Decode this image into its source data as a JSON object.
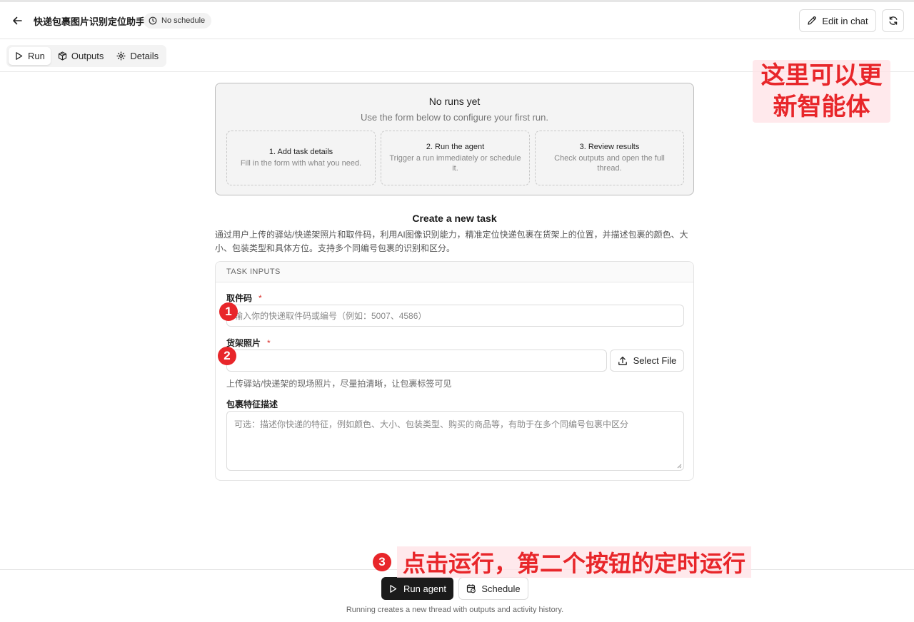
{
  "header": {
    "title": "快递包裹图片识别定位助手",
    "schedule_badge": "No schedule",
    "edit_chat_label": "Edit in chat"
  },
  "tabs": [
    {
      "label": "Run",
      "icon": "play-icon",
      "active": true
    },
    {
      "label": "Outputs",
      "icon": "box-icon",
      "active": false
    },
    {
      "label": "Details",
      "icon": "gear-icon",
      "active": false
    }
  ],
  "empty_state": {
    "title": "No runs yet",
    "subtitle": "Use the form below to configure your first run.",
    "steps": [
      {
        "title": "1. Add task details",
        "desc": "Fill in the form with what you need."
      },
      {
        "title": "2. Run the agent",
        "desc": "Trigger a run immediately or schedule it."
      },
      {
        "title": "3. Review results",
        "desc": "Check outputs and open the full thread."
      }
    ]
  },
  "create": {
    "title": "Create a new task",
    "description": "通过用户上传的驿站/快递架照片和取件码，利用AI图像识别能力，精准定位快递包裹在货架上的位置，并描述包裹的颜色、大小、包装类型和具体方位。支持多个同编号包裹的识别和区分。",
    "inputs_header": "TASK INPUTS",
    "fields": {
      "pickup_code": {
        "label": "取件码",
        "required_mark": "*",
        "placeholder": "输入你的快递取件码或编号（例如：5007、4586）"
      },
      "shelf_photo": {
        "label": "货架照片",
        "required_mark": "*",
        "select_label": "Select File",
        "hint": "上传驿站/快递架的现场照片，尽量拍清晰，让包裹标签可见"
      },
      "package_desc": {
        "label": "包裹特征描述",
        "placeholder": "可选：描述你快递的特征，例如颜色、大小、包装类型、购买的商品等，有助于在多个同编号包裹中区分"
      }
    }
  },
  "footer": {
    "run_label": "Run agent",
    "schedule_label": "Schedule",
    "note": "Running creates a new thread with outputs and activity history."
  },
  "annotations": {
    "badge_1": "1",
    "badge_2": "2",
    "badge_3": "3",
    "note_line1": "这里可以更",
    "note_line2": "新智能体",
    "bottom_text": "点击运行，第二个按钮的定时运行"
  },
  "colors": {
    "accent_red": "#e8262a",
    "primary_dark": "#1b1b1b"
  }
}
